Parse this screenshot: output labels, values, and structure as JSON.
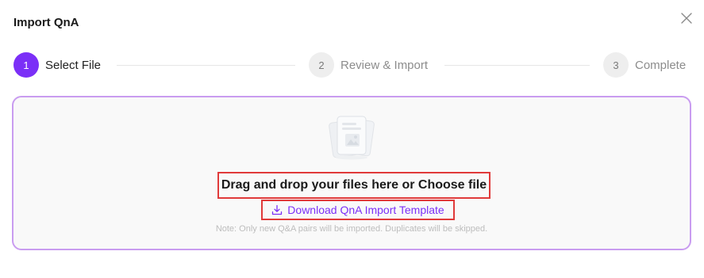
{
  "dialog": {
    "title": "Import QnA"
  },
  "steps": [
    {
      "number": "1",
      "label": "Select File",
      "state": "active"
    },
    {
      "number": "2",
      "label": "Review & Import",
      "state": "inactive"
    },
    {
      "number": "3",
      "label": "Complete",
      "state": "inactive"
    }
  ],
  "dropzone": {
    "instruction": "Drag and drop your files here or Choose file",
    "template_link": "Download QnA Import Template",
    "note": "Note: Only new Q&A pairs will be imported. Duplicates will be skipped."
  },
  "icons": {
    "close": "close-icon",
    "file_illustration": "document-stack-icon",
    "download": "download-icon"
  },
  "colors": {
    "accent": "#7b2ff7",
    "dropzone_border": "#c99cf0",
    "highlight_border": "#e03a3a"
  }
}
